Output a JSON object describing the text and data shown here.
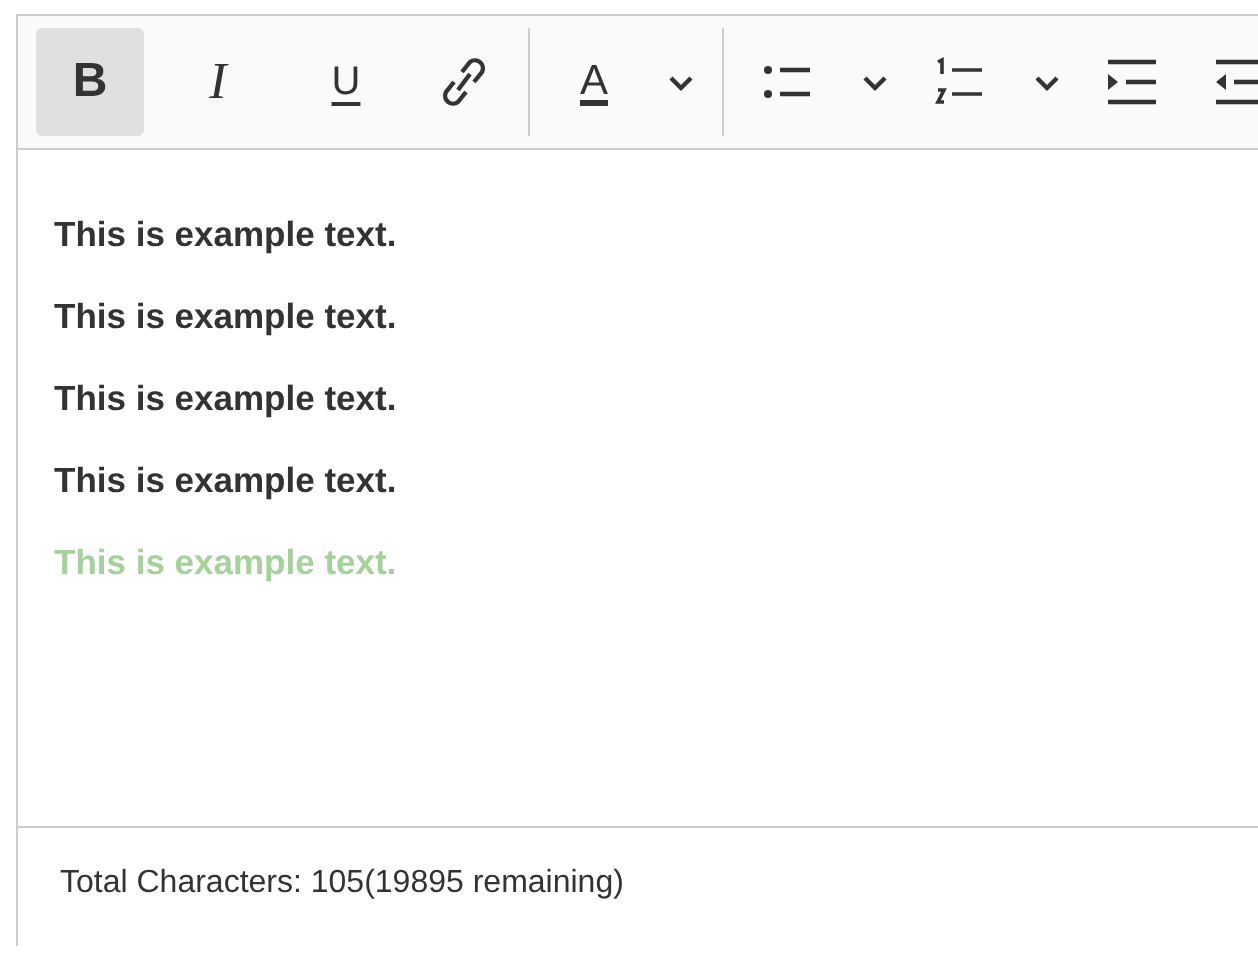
{
  "toolbar": {
    "items": [
      {
        "kind": "bold",
        "label": "B",
        "selected": true
      },
      {
        "kind": "italic",
        "label": "I",
        "selected": false
      },
      {
        "kind": "underline",
        "label": "U",
        "selected": false
      },
      {
        "kind": "link",
        "selected": false
      },
      {
        "kind": "separator"
      },
      {
        "kind": "font-color",
        "label": "A",
        "selected": false
      },
      {
        "kind": "dropdown",
        "selected": false
      },
      {
        "kind": "separator"
      },
      {
        "kind": "bullet-list",
        "selected": false
      },
      {
        "kind": "dropdown",
        "selected": false
      },
      {
        "kind": "numbered-list",
        "selected": false
      },
      {
        "kind": "dropdown",
        "selected": false
      },
      {
        "kind": "indent",
        "selected": false
      },
      {
        "kind": "outdent",
        "selected": false
      }
    ]
  },
  "paragraphs": [
    {
      "text": "This is example text.",
      "color": "#333333"
    },
    {
      "text": "This is example text.",
      "color": "#333333"
    },
    {
      "text": "This is example text.",
      "color": "#333333"
    },
    {
      "text": "This is example text.",
      "color": "#333333"
    },
    {
      "text": "This is example text.",
      "color": "#a5d19a"
    }
  ],
  "footer": {
    "text": "Total Characters: 105(19895 remaining)"
  }
}
